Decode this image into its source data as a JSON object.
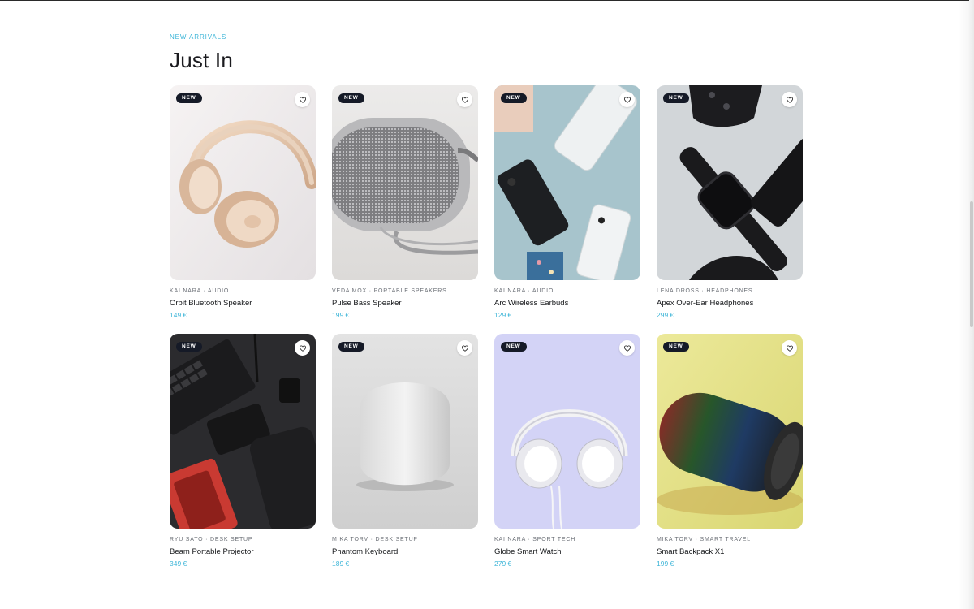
{
  "section": {
    "eyebrow": "NEW ARRIVALS",
    "title": "Just In"
  },
  "badge_label": "NEW",
  "accent_color": "#3fb6d8",
  "products": [
    {
      "meta": "KAI NARA · AUDIO",
      "name": "Orbit Bluetooth Speaker",
      "price": "149 €",
      "image": "rose-gold-headphones"
    },
    {
      "meta": "VEDA MOX · PORTABLE SPEAKERS",
      "name": "Pulse Bass Speaker",
      "price": "199 €",
      "image": "grey-portable-speaker"
    },
    {
      "meta": "KAI NARA · AUDIO",
      "name": "Arc Wireless Earbuds",
      "price": "129 €",
      "image": "phones-flatlay"
    },
    {
      "meta": "LENA DROSS · HEADPHONES",
      "name": "Apex Over-Ear Headphones",
      "price": "299 €",
      "image": "smartwatch-controller"
    },
    {
      "meta": "RYU SATO · DESK SETUP",
      "name": "Beam Portable Projector",
      "price": "349 €",
      "image": "desk-gadgets-flatlay"
    },
    {
      "meta": "MIKA TORV · DESK SETUP",
      "name": "Phantom Keyboard",
      "price": "189 €",
      "image": "white-smart-speaker"
    },
    {
      "meta": "KAI NARA · SPORT TECH",
      "name": "Globe Smart Watch",
      "price": "279 €",
      "image": "white-headphones"
    },
    {
      "meta": "MIKA TORV · SMART TRAVEL",
      "name": "Smart Backpack X1",
      "price": "199 €",
      "image": "cylinder-speaker"
    }
  ]
}
